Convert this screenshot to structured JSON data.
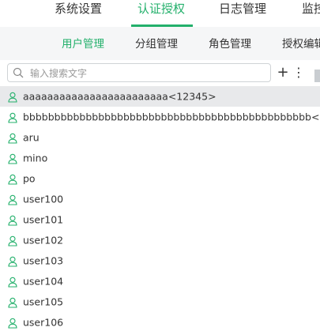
{
  "top_nav": {
    "tabs": [
      {
        "label": "系统设置",
        "active": false
      },
      {
        "label": "认证授权",
        "active": true
      },
      {
        "label": "日志管理",
        "active": false
      },
      {
        "label": "监控",
        "active": false
      }
    ]
  },
  "sub_nav": {
    "tabs": [
      {
        "label": "用户管理",
        "active": true
      },
      {
        "label": "分组管理",
        "active": false
      },
      {
        "label": "角色管理",
        "active": false
      },
      {
        "label": "授权编辑",
        "active": false
      }
    ]
  },
  "toolbar": {
    "search_placeholder": "输入搜索文字",
    "add_label": "+",
    "more_label": "⋮"
  },
  "users": [
    "aaaaaaaaaaaaaaaaaaaaaaaa<12345>",
    "bbbbbbbbbbbbbbbbbbbbbbbbbbbbbbbbbbbbbbbbbbbbbb<admin>",
    "aru",
    "mino",
    "po",
    "user100",
    "user101",
    "user102",
    "user103",
    "user104",
    "user105",
    "user106"
  ],
  "colors": {
    "accent": "#23b06b",
    "subnav_bg": "#f5f6f7",
    "selected_row_bg": "#e8e9eb",
    "user_icon": "#23b06b"
  }
}
